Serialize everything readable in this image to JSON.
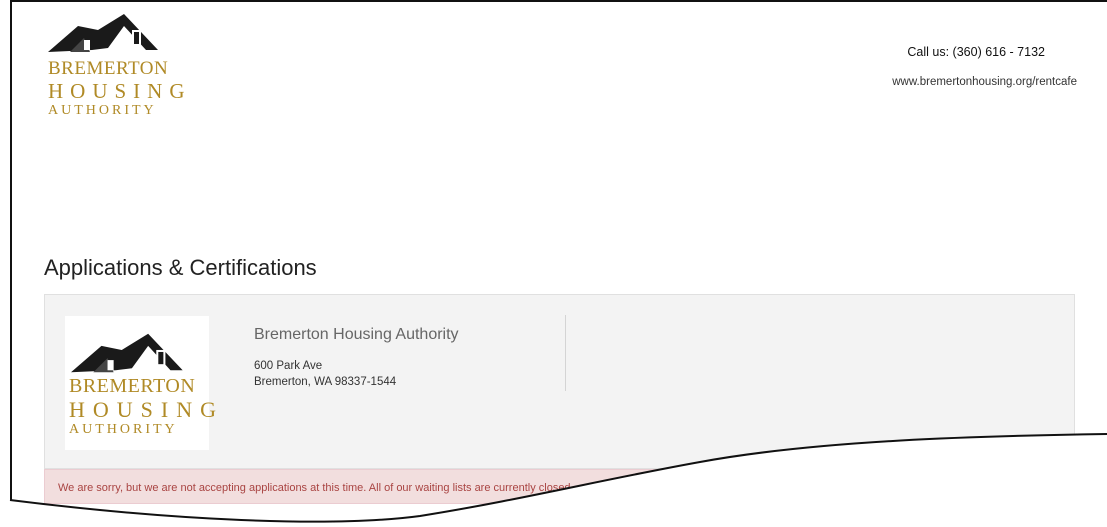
{
  "header": {
    "logo": {
      "line1": "BREMERTON",
      "line2": "HOUSING",
      "line3": "AUTHORITY",
      "icon": "house-roof-logo"
    },
    "call_us": "Call us: (360) 616 - 7132",
    "website": "www.bremertonhousing.org/rentcafe"
  },
  "main": {
    "title": "Applications & Certifications",
    "property": {
      "logo": {
        "line1": "BREMERTON",
        "line2": "HOUSING",
        "line3": "AUTHORITY"
      },
      "name": "Bremerton Housing Authority",
      "address_line1": "600 Park Ave",
      "address_line2": "Bremerton, WA 98337-1544"
    },
    "alert": "We are sorry, but we are not accepting applications at this time. All of our waiting lists are currently closed."
  },
  "colors": {
    "logo_gold": "#b08a26",
    "alert_bg": "#f2dede",
    "alert_text": "#a94442",
    "panel_bg": "#f3f3f3"
  }
}
